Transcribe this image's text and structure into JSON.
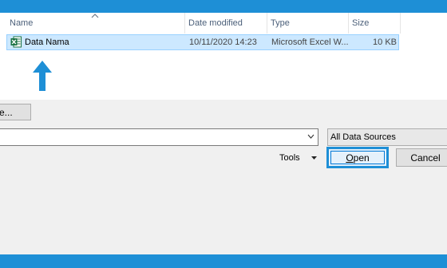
{
  "columns": [
    {
      "label": "Name"
    },
    {
      "label": "Date modified"
    },
    {
      "label": "Type"
    },
    {
      "label": "Size"
    }
  ],
  "files": [
    {
      "name": "Data Nama",
      "date_modified": "10/11/2020 14:23",
      "type": "Microsoft Excel W...",
      "size": "10 KB",
      "icon": "excel-file-icon",
      "selected": true
    }
  ],
  "annotation": {
    "icon": "up-arrow-icon",
    "color": "#1e8fd6"
  },
  "left_button_label": "e...",
  "filename_value": "",
  "file_type_filter": "All Data Sources",
  "tools_label": "Tools",
  "open_label": "Open",
  "cancel_label": "Cancel",
  "colors": {
    "frame": "#1e8fd6",
    "selection": "#cce8ff",
    "selection_border": "#99d1ff",
    "excel_green": "#1d7345"
  }
}
